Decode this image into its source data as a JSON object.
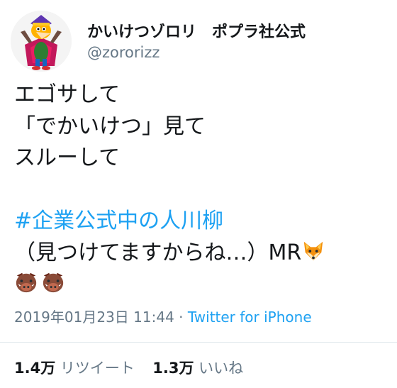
{
  "user": {
    "display_name": "かいけつゾロリ　ポプラ社公式",
    "handle": "@zororizz",
    "avatar_icon": "zorori-character-avatar"
  },
  "tweet": {
    "line1": "エゴサして",
    "line2": "「でかいけつ」見て",
    "line3": "スルーして",
    "hashtag": "#企業公式中の人川柳",
    "line5": "（見つけてますからね…）MR",
    "emoji_fox": "fox-face-emoji",
    "emoji_boar": "boar-face-emoji",
    "emoji_boar_count": 2
  },
  "meta": {
    "timestamp": "2019年01月23日 11:44",
    "separator": " · ",
    "source": "Twitter for iPhone"
  },
  "stats": {
    "retweets_count": "1.4万",
    "retweets_label": "リツイート",
    "likes_count": "1.3万",
    "likes_label": "いいね"
  },
  "colors": {
    "link": "#1da1f2",
    "secondary": "#657786",
    "text": "#14171a",
    "divider": "#e1e8ed"
  }
}
